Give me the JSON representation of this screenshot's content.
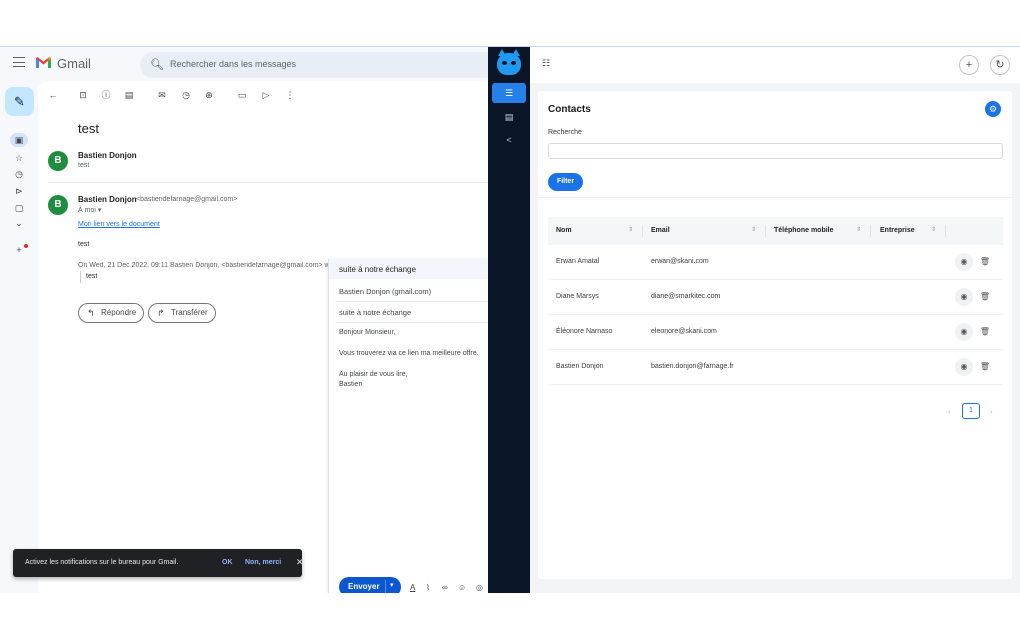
{
  "gmail": {
    "brand": "Gmail",
    "search_placeholder": "Rechercher dans les messages",
    "subject": "test",
    "messages": [
      {
        "avatar": "B",
        "sender": "Bastien Donjon",
        "snippet": "test"
      },
      {
        "avatar": "B",
        "sender": "Bastien Donjon",
        "email": "<bastiendefarnage@gmail.com>",
        "to": "À moi ▾",
        "link": "Mon lien vers le document",
        "body": "test",
        "quote_header": "On Wed, 21 Dec 2022, 09:11 Bastien Donjon, <bastiendefarnage@gmail.com> w",
        "quote_body": "test"
      }
    ],
    "reply_label": "Répondre",
    "forward_label": "Transférer"
  },
  "reply_popup": {
    "header": "suite à notre échange",
    "to": "Bastien Donjon (gmail.com)",
    "subject": "suite à notre échange",
    "greeting": "Bonjour Monsieur,",
    "line": "Vous trouverez via ce lien ma meilleure offre.",
    "closing": "Au plaisir de vous lire,",
    "signature": "Bastien",
    "send_label": "Envoyer"
  },
  "toast": {
    "message": "Activez les notifications sur le bureau pour Gmail.",
    "ok": "OK",
    "dismiss": "Non, merci",
    "close": "✕"
  },
  "contacts": {
    "title": "Contacts",
    "search_label": "Recherche",
    "filter_label": "Filter",
    "columns": [
      "Nom",
      "Email",
      "Téléphone mobile",
      "Entreprise"
    ],
    "rows": [
      {
        "name": "Erwan Amatal",
        "email": "erwan@skani.com"
      },
      {
        "name": "Diane Marsys",
        "email": "diane@smarkitec.com"
      },
      {
        "name": "Éléonore Narnaso",
        "email": "eleonore@skani.com"
      },
      {
        "name": "Bastien Donjon",
        "email": "bastien.donjon@farnage.fr"
      }
    ],
    "pagination": {
      "prev": "‹",
      "current": "1",
      "next": "›"
    }
  },
  "colors": {
    "primary": "#1a73e8",
    "ext_rail": "#0a1628",
    "gmail_bg": "#f6f8fc",
    "avatar": "#1e8e3e"
  }
}
